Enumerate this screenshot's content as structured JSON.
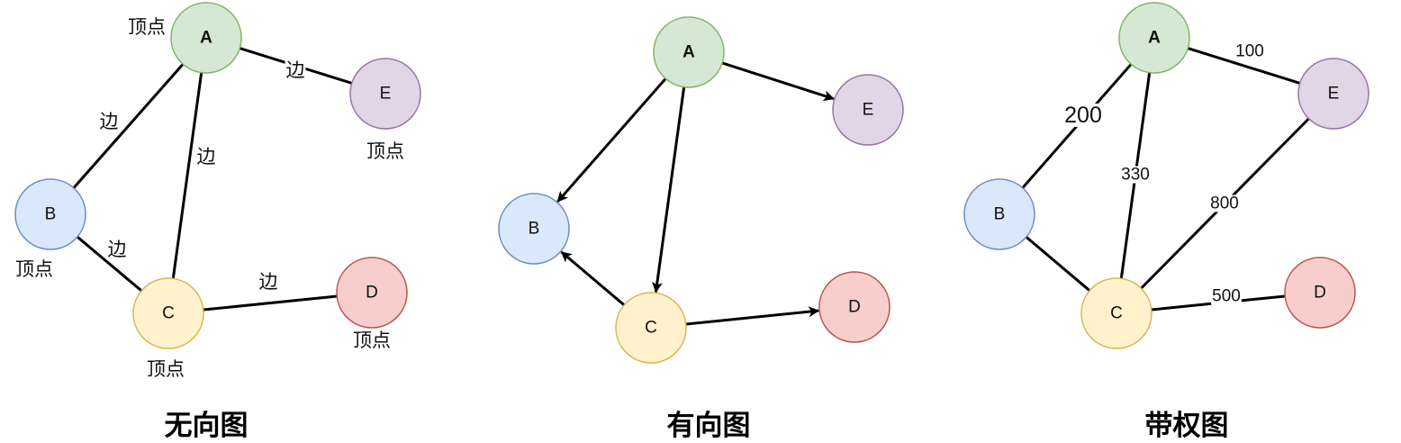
{
  "colors": {
    "green": {
      "fill": "#d5e8d4",
      "stroke": "#82b366"
    },
    "purple": {
      "fill": "#e1d5e7",
      "stroke": "#9673a6"
    },
    "blue": {
      "fill": "#dae8fc",
      "stroke": "#6c8ebf"
    },
    "yellow": {
      "fill": "#fff2cc",
      "stroke": "#d6b656"
    },
    "red": {
      "fill": "#f8cecc",
      "stroke": "#b85450"
    }
  },
  "graphs": [
    {
      "id": "undirected",
      "title": "无向图",
      "directed": false,
      "nodes": [
        {
          "id": "A",
          "label": "A",
          "color": "green",
          "bold": true
        },
        {
          "id": "E",
          "label": "E",
          "color": "purple",
          "bold": false
        },
        {
          "id": "B",
          "label": "B",
          "color": "blue",
          "bold": false
        },
        {
          "id": "C",
          "label": "C",
          "color": "yellow",
          "bold": false
        },
        {
          "id": "D",
          "label": "D",
          "color": "red",
          "bold": false
        }
      ],
      "edges": [
        {
          "from": "A",
          "to": "E",
          "label": "边"
        },
        {
          "from": "A",
          "to": "B",
          "label": "边"
        },
        {
          "from": "A",
          "to": "C",
          "label": "边"
        },
        {
          "from": "B",
          "to": "C",
          "label": "边"
        },
        {
          "from": "C",
          "to": "D",
          "label": "边"
        }
      ],
      "vertex_labels": [
        {
          "node": "A",
          "text": "顶点"
        },
        {
          "node": "E",
          "text": "顶点"
        },
        {
          "node": "B",
          "text": "顶点"
        },
        {
          "node": "C",
          "text": "顶点"
        },
        {
          "node": "D",
          "text": "顶点"
        }
      ]
    },
    {
      "id": "directed",
      "title": "有向图",
      "directed": true,
      "nodes": [
        {
          "id": "A",
          "label": "A",
          "color": "green",
          "bold": true
        },
        {
          "id": "E",
          "label": "E",
          "color": "purple",
          "bold": false
        },
        {
          "id": "B",
          "label": "B",
          "color": "blue",
          "bold": false
        },
        {
          "id": "C",
          "label": "C",
          "color": "yellow",
          "bold": false
        },
        {
          "id": "D",
          "label": "D",
          "color": "red",
          "bold": false
        }
      ],
      "edges": [
        {
          "from": "A",
          "to": "E"
        },
        {
          "from": "A",
          "to": "B"
        },
        {
          "from": "A",
          "to": "C"
        },
        {
          "from": "C",
          "to": "B"
        },
        {
          "from": "C",
          "to": "D"
        }
      ]
    },
    {
      "id": "weighted",
      "title": "带权图",
      "directed": false,
      "nodes": [
        {
          "id": "A",
          "label": "A",
          "color": "green",
          "bold": true
        },
        {
          "id": "E",
          "label": "E",
          "color": "purple",
          "bold": false
        },
        {
          "id": "B",
          "label": "B",
          "color": "blue",
          "bold": false
        },
        {
          "id": "C",
          "label": "C",
          "color": "yellow",
          "bold": false
        },
        {
          "id": "D",
          "label": "D",
          "color": "red",
          "bold": false
        }
      ],
      "edges": [
        {
          "from": "A",
          "to": "E",
          "label": "100"
        },
        {
          "from": "A",
          "to": "B",
          "label": "200"
        },
        {
          "from": "A",
          "to": "C",
          "label": "330"
        },
        {
          "from": "E",
          "to": "C",
          "label": "800"
        },
        {
          "from": "B",
          "to": "C"
        },
        {
          "from": "C",
          "to": "D",
          "label": "500"
        }
      ]
    }
  ]
}
